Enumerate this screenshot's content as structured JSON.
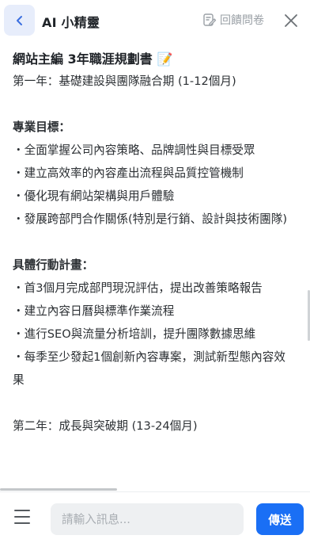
{
  "header": {
    "title": "AI 小精靈",
    "feedback_label": "回饋問卷"
  },
  "document": {
    "title": "網站主編 3年職涯規劃書",
    "title_emoji": "📝",
    "lines": [
      {
        "text": "第一年：基礎建設與團隊融合期 (1-12個月)",
        "bold": false
      },
      {
        "text": "",
        "bold": false
      },
      {
        "text": "專業目標：",
        "bold": true
      },
      {
        "text": "・全面掌握公司內容策略、品牌調性與目標受眾",
        "bold": false
      },
      {
        "text": "・建立高效率的內容產出流程與品質控管機制",
        "bold": false
      },
      {
        "text": "・優化現有網站架構與用戶體驗",
        "bold": false
      },
      {
        "text": "・發展跨部門合作關係(特別是行銷、設計與技術團隊)",
        "bold": false
      },
      {
        "text": "",
        "bold": false
      },
      {
        "text": "具體行動計畫：",
        "bold": true
      },
      {
        "text": "・首3個月完成部門現況評估，提出改善策略報告",
        "bold": false
      },
      {
        "text": "・建立內容日曆與標準作業流程",
        "bold": false
      },
      {
        "text": "・進行SEO與流量分析培訓，提升團隊數據思維",
        "bold": false
      },
      {
        "text": "・每季至少發起1個創新內容專案，測試新型態內容效果",
        "bold": false
      },
      {
        "text": "",
        "bold": false
      },
      {
        "text": "第二年：成長與突破期 (13-24個月)",
        "bold": false
      }
    ]
  },
  "footer": {
    "input_placeholder": "請輸入訊息...",
    "send_label": "傳送"
  },
  "colors": {
    "accent": "#1a6ff5",
    "back_button_bg": "#e7edfb",
    "input_bg": "#eef0f2",
    "muted": "#9aa0a6"
  }
}
